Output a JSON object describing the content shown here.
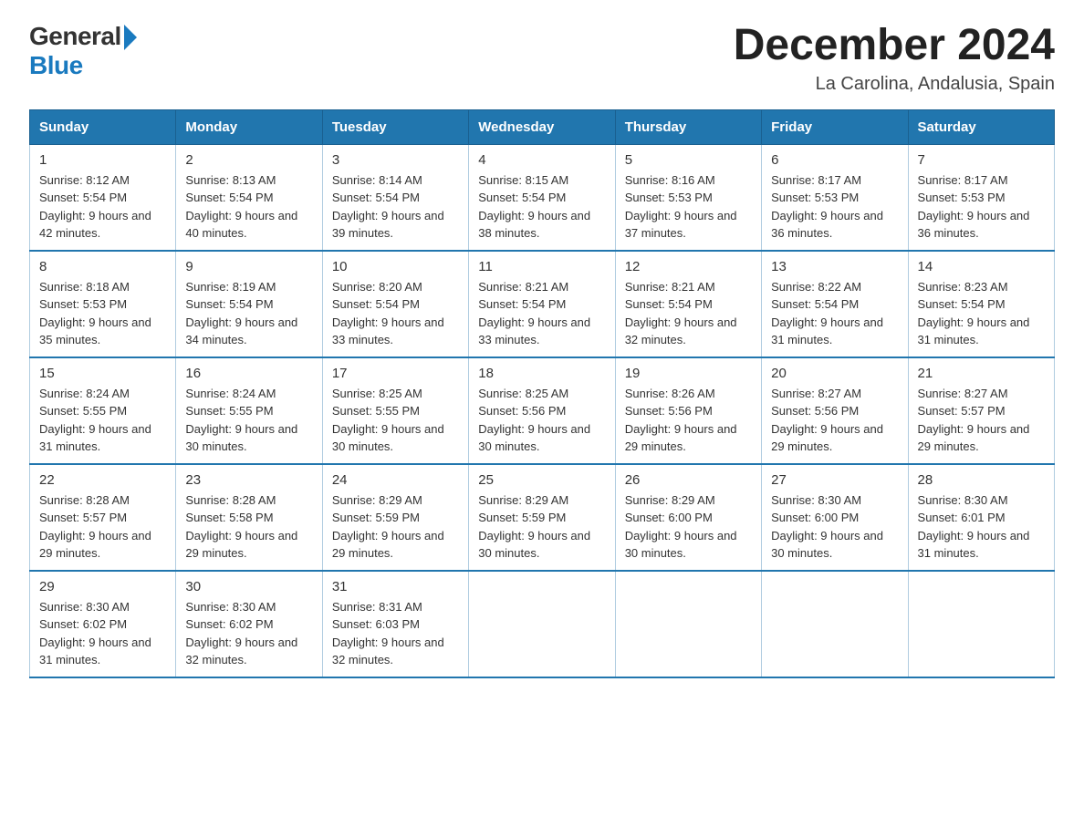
{
  "logo": {
    "general": "General",
    "blue": "Blue"
  },
  "title": "December 2024",
  "location": "La Carolina, Andalusia, Spain",
  "headers": [
    "Sunday",
    "Monday",
    "Tuesday",
    "Wednesday",
    "Thursday",
    "Friday",
    "Saturday"
  ],
  "weeks": [
    [
      {
        "day": "1",
        "sunrise": "8:12 AM",
        "sunset": "5:54 PM",
        "daylight": "9 hours and 42 minutes."
      },
      {
        "day": "2",
        "sunrise": "8:13 AM",
        "sunset": "5:54 PM",
        "daylight": "9 hours and 40 minutes."
      },
      {
        "day": "3",
        "sunrise": "8:14 AM",
        "sunset": "5:54 PM",
        "daylight": "9 hours and 39 minutes."
      },
      {
        "day": "4",
        "sunrise": "8:15 AM",
        "sunset": "5:54 PM",
        "daylight": "9 hours and 38 minutes."
      },
      {
        "day": "5",
        "sunrise": "8:16 AM",
        "sunset": "5:53 PM",
        "daylight": "9 hours and 37 minutes."
      },
      {
        "day": "6",
        "sunrise": "8:17 AM",
        "sunset": "5:53 PM",
        "daylight": "9 hours and 36 minutes."
      },
      {
        "day": "7",
        "sunrise": "8:17 AM",
        "sunset": "5:53 PM",
        "daylight": "9 hours and 36 minutes."
      }
    ],
    [
      {
        "day": "8",
        "sunrise": "8:18 AM",
        "sunset": "5:53 PM",
        "daylight": "9 hours and 35 minutes."
      },
      {
        "day": "9",
        "sunrise": "8:19 AM",
        "sunset": "5:54 PM",
        "daylight": "9 hours and 34 minutes."
      },
      {
        "day": "10",
        "sunrise": "8:20 AM",
        "sunset": "5:54 PM",
        "daylight": "9 hours and 33 minutes."
      },
      {
        "day": "11",
        "sunrise": "8:21 AM",
        "sunset": "5:54 PM",
        "daylight": "9 hours and 33 minutes."
      },
      {
        "day": "12",
        "sunrise": "8:21 AM",
        "sunset": "5:54 PM",
        "daylight": "9 hours and 32 minutes."
      },
      {
        "day": "13",
        "sunrise": "8:22 AM",
        "sunset": "5:54 PM",
        "daylight": "9 hours and 31 minutes."
      },
      {
        "day": "14",
        "sunrise": "8:23 AM",
        "sunset": "5:54 PM",
        "daylight": "9 hours and 31 minutes."
      }
    ],
    [
      {
        "day": "15",
        "sunrise": "8:24 AM",
        "sunset": "5:55 PM",
        "daylight": "9 hours and 31 minutes."
      },
      {
        "day": "16",
        "sunrise": "8:24 AM",
        "sunset": "5:55 PM",
        "daylight": "9 hours and 30 minutes."
      },
      {
        "day": "17",
        "sunrise": "8:25 AM",
        "sunset": "5:55 PM",
        "daylight": "9 hours and 30 minutes."
      },
      {
        "day": "18",
        "sunrise": "8:25 AM",
        "sunset": "5:56 PM",
        "daylight": "9 hours and 30 minutes."
      },
      {
        "day": "19",
        "sunrise": "8:26 AM",
        "sunset": "5:56 PM",
        "daylight": "9 hours and 29 minutes."
      },
      {
        "day": "20",
        "sunrise": "8:27 AM",
        "sunset": "5:56 PM",
        "daylight": "9 hours and 29 minutes."
      },
      {
        "day": "21",
        "sunrise": "8:27 AM",
        "sunset": "5:57 PM",
        "daylight": "9 hours and 29 minutes."
      }
    ],
    [
      {
        "day": "22",
        "sunrise": "8:28 AM",
        "sunset": "5:57 PM",
        "daylight": "9 hours and 29 minutes."
      },
      {
        "day": "23",
        "sunrise": "8:28 AM",
        "sunset": "5:58 PM",
        "daylight": "9 hours and 29 minutes."
      },
      {
        "day": "24",
        "sunrise": "8:29 AM",
        "sunset": "5:59 PM",
        "daylight": "9 hours and 29 minutes."
      },
      {
        "day": "25",
        "sunrise": "8:29 AM",
        "sunset": "5:59 PM",
        "daylight": "9 hours and 30 minutes."
      },
      {
        "day": "26",
        "sunrise": "8:29 AM",
        "sunset": "6:00 PM",
        "daylight": "9 hours and 30 minutes."
      },
      {
        "day": "27",
        "sunrise": "8:30 AM",
        "sunset": "6:00 PM",
        "daylight": "9 hours and 30 minutes."
      },
      {
        "day": "28",
        "sunrise": "8:30 AM",
        "sunset": "6:01 PM",
        "daylight": "9 hours and 31 minutes."
      }
    ],
    [
      {
        "day": "29",
        "sunrise": "8:30 AM",
        "sunset": "6:02 PM",
        "daylight": "9 hours and 31 minutes."
      },
      {
        "day": "30",
        "sunrise": "8:30 AM",
        "sunset": "6:02 PM",
        "daylight": "9 hours and 32 minutes."
      },
      {
        "day": "31",
        "sunrise": "8:31 AM",
        "sunset": "6:03 PM",
        "daylight": "9 hours and 32 minutes."
      },
      null,
      null,
      null,
      null
    ]
  ]
}
